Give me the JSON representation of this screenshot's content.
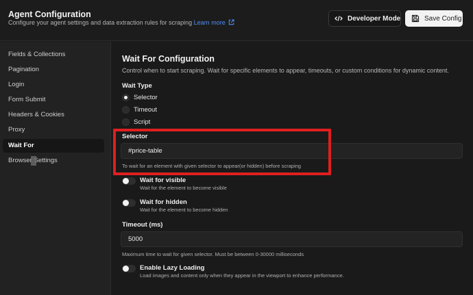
{
  "header": {
    "title": "Agent Configuration",
    "subtitle": "Configure your agent settings and data extraction rules for scraping",
    "learn_more": "Learn more",
    "developer_mode": "Developer Mode",
    "save_config": "Save Config"
  },
  "sidebar": {
    "items": [
      {
        "label": "Fields & Collections"
      },
      {
        "label": "Pagination"
      },
      {
        "label": "Login"
      },
      {
        "label": "Form Submit"
      },
      {
        "label": "Headers & Cookies"
      },
      {
        "label": "Proxy"
      },
      {
        "label": "Wait For",
        "active": true
      },
      {
        "label": "Browser Settings"
      }
    ]
  },
  "main": {
    "title": "Wait For Configuration",
    "description": "Control when to start scraping. Wait for specific elements to appear, timeouts, or custom conditions for dynamic content.",
    "wait_type": {
      "label": "Wait Type",
      "options": [
        {
          "label": "Selector",
          "checked": true
        },
        {
          "label": "Timeout",
          "checked": false
        },
        {
          "label": "Script",
          "checked": false
        }
      ]
    },
    "selector": {
      "label": "Selector",
      "value": "#price-table",
      "help": "To wait for an element with given selector to appear(or hidden) before scraping"
    },
    "wait_visible": {
      "label": "Wait for visible",
      "desc": "Wait for the element to become visible",
      "on": false
    },
    "wait_hidden": {
      "label": "Wait for hidden",
      "desc": "Wait for the element to become hidden",
      "on": false
    },
    "timeout": {
      "label": "Timeout (ms)",
      "value": "5000",
      "help": "Maximum time to wait for given selector. Must be between 0-30000 milliseconds"
    },
    "lazy_loading": {
      "label": "Enable Lazy Loading",
      "desc": "Load images and content only when they appear in the viewport to enhance performance.",
      "on": false
    }
  },
  "colors": {
    "highlight": "#e01f1f",
    "link": "#4f8df5"
  }
}
